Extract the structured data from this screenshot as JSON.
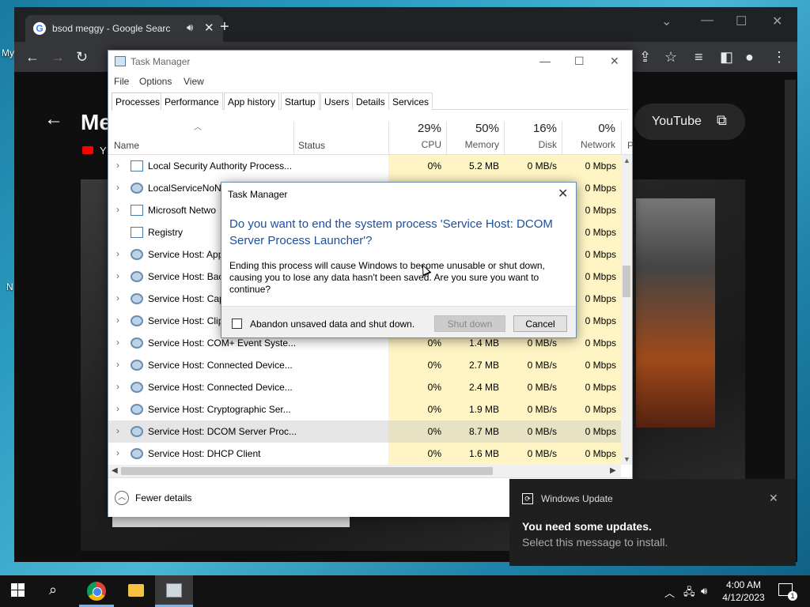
{
  "desktop": {
    "labels": [
      "My",
      "N"
    ]
  },
  "browser": {
    "tab_title": "bsod meggy - Google Search",
    "new_tab": "+",
    "content": {
      "page_title": "Me",
      "channel_initial": "Y",
      "youtube_button": "YouTube"
    }
  },
  "task_manager": {
    "title": "Task Manager",
    "menu": [
      "File",
      "Options",
      "View"
    ],
    "tabs": [
      "Processes",
      "Performance",
      "App history",
      "Startup",
      "Users",
      "Details",
      "Services"
    ],
    "active_tab": "Processes",
    "columns": {
      "name": "Name",
      "status": "Status",
      "cpu": {
        "pct": "29%",
        "label": "CPU"
      },
      "memory": {
        "pct": "50%",
        "label": "Memory"
      },
      "disk": {
        "pct": "16%",
        "label": "Disk"
      },
      "network": {
        "pct": "0%",
        "label": "Network"
      },
      "power": "P"
    },
    "rows": [
      {
        "name": "Local Security Authority Process...",
        "icon": "window",
        "cpu": "0%",
        "mem": "5.2 MB",
        "disk": "0 MB/s",
        "net": "0 Mbps",
        "expandable": true
      },
      {
        "name": "LocalServiceNoN",
        "icon": "gear",
        "cpu": "",
        "mem": "",
        "disk": "",
        "net": "0 Mbps",
        "expandable": true
      },
      {
        "name": "Microsoft Netwo",
        "icon": "window",
        "cpu": "",
        "mem": "",
        "disk": "",
        "net": "0 Mbps",
        "expandable": true
      },
      {
        "name": "Registry",
        "icon": "window",
        "cpu": "",
        "mem": "",
        "disk": "",
        "net": "0 Mbps",
        "expandable": false
      },
      {
        "name": "Service Host: App",
        "icon": "gear",
        "cpu": "",
        "mem": "",
        "disk": "",
        "net": "0 Mbps",
        "expandable": true
      },
      {
        "name": "Service Host: Bac",
        "icon": "gear",
        "cpu": "",
        "mem": "",
        "disk": "",
        "net": "0 Mbps",
        "expandable": true
      },
      {
        "name": "Service Host: Cap",
        "icon": "gear",
        "cpu": "",
        "mem": "",
        "disk": "",
        "net": "0 Mbps",
        "expandable": true
      },
      {
        "name": "Service Host: Clip",
        "icon": "gear",
        "cpu": "",
        "mem": "",
        "disk": "",
        "net": "0 Mbps",
        "expandable": true
      },
      {
        "name": "Service Host: COM+ Event Syste...",
        "icon": "gear",
        "cpu": "0%",
        "mem": "1.4 MB",
        "disk": "0 MB/s",
        "net": "0 Mbps",
        "expandable": true
      },
      {
        "name": "Service Host: Connected Device...",
        "icon": "gear",
        "cpu": "0%",
        "mem": "2.7 MB",
        "disk": "0 MB/s",
        "net": "0 Mbps",
        "expandable": true
      },
      {
        "name": "Service Host: Connected Device...",
        "icon": "gear",
        "cpu": "0%",
        "mem": "2.4 MB",
        "disk": "0 MB/s",
        "net": "0 Mbps",
        "expandable": true
      },
      {
        "name": "Service Host: Cryptographic Ser...",
        "icon": "gear",
        "cpu": "0%",
        "mem": "1.9 MB",
        "disk": "0 MB/s",
        "net": "0 Mbps",
        "expandable": true
      },
      {
        "name": "Service Host: DCOM Server Proc...",
        "icon": "gear",
        "cpu": "0%",
        "mem": "8.7 MB",
        "disk": "0 MB/s",
        "net": "0 Mbps",
        "expandable": true,
        "selected": true
      },
      {
        "name": "Service Host: DHCP Client",
        "icon": "gear",
        "cpu": "0%",
        "mem": "1.6 MB",
        "disk": "0 MB/s",
        "net": "0 Mbps",
        "expandable": true
      }
    ],
    "footer": {
      "fewer_details": "Fewer details"
    }
  },
  "dialog": {
    "title": "Task Manager",
    "question": "Do you want to end the system process 'Service Host: DCOM Server Process Launcher'?",
    "message": "Ending this process will cause Windows to become unusable or shut down, causing you to lose any data hasn't been saved. Are you sure you want to continue?",
    "checkbox_label": "Abandon unsaved data and shut down.",
    "shutdown_button": "Shut down",
    "cancel_button": "Cancel"
  },
  "toast": {
    "app": "Windows Update",
    "heading": "You need some updates.",
    "body": "Select this message to install."
  },
  "taskbar": {
    "time": "4:00 AM",
    "date": "4/12/2023",
    "notification_count": "1"
  }
}
